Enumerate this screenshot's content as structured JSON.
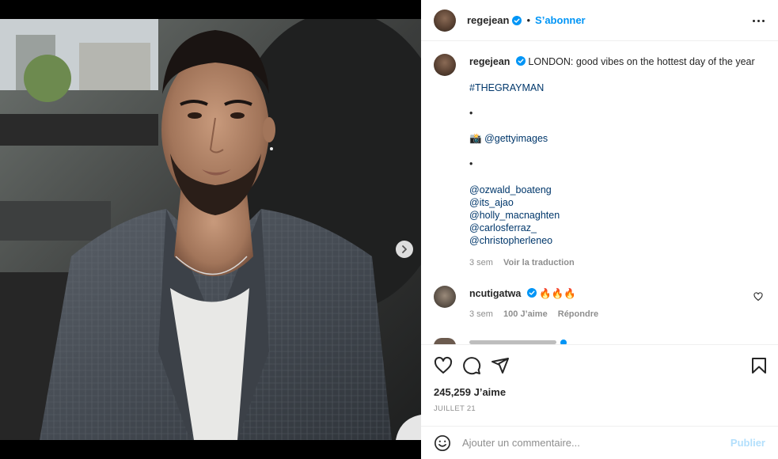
{
  "post": {
    "author": "regejean",
    "follow_label": "S’abonner",
    "separator": "•",
    "caption": {
      "username": "regejean",
      "text": "LONDON: good vibes on the hottest day of the year",
      "hashtag": "#THEGRAYMAN",
      "bullet1": "•",
      "photo_credit_emoji": "📸",
      "photo_credit": "@gettyimages",
      "bullet2": "•",
      "mentions": [
        "@ozwald_boateng",
        "@its_ajao",
        "@holly_macnaghten",
        "@carlosferraz_",
        "@christopherleneo"
      ],
      "time": "3 sem",
      "translate_label": "Voir la traduction"
    },
    "comments": [
      {
        "username": "ncutigatwa",
        "text": "🔥🔥🔥",
        "time": "3 sem",
        "likes": "100 J’aime",
        "reply_label": "Répondre"
      }
    ],
    "likes": "245,259 J’aime",
    "date": "JUILLET 21",
    "comment_placeholder": "Ajouter un commentaire...",
    "publish_label": "Publier",
    "carousel": {
      "count": 7,
      "active": 0
    }
  },
  "icons": {
    "verified": "verified-badge-icon",
    "more": "more-options-icon",
    "like": "heart-icon",
    "comment": "comment-icon",
    "share": "share-icon",
    "save": "bookmark-icon",
    "emoji": "emoji-icon",
    "next": "chevron-right-icon"
  },
  "colors": {
    "accent": "#0095f6",
    "link": "#00376b",
    "muted": "#8e8e8e",
    "publish_disabled": "#b2dffc"
  }
}
